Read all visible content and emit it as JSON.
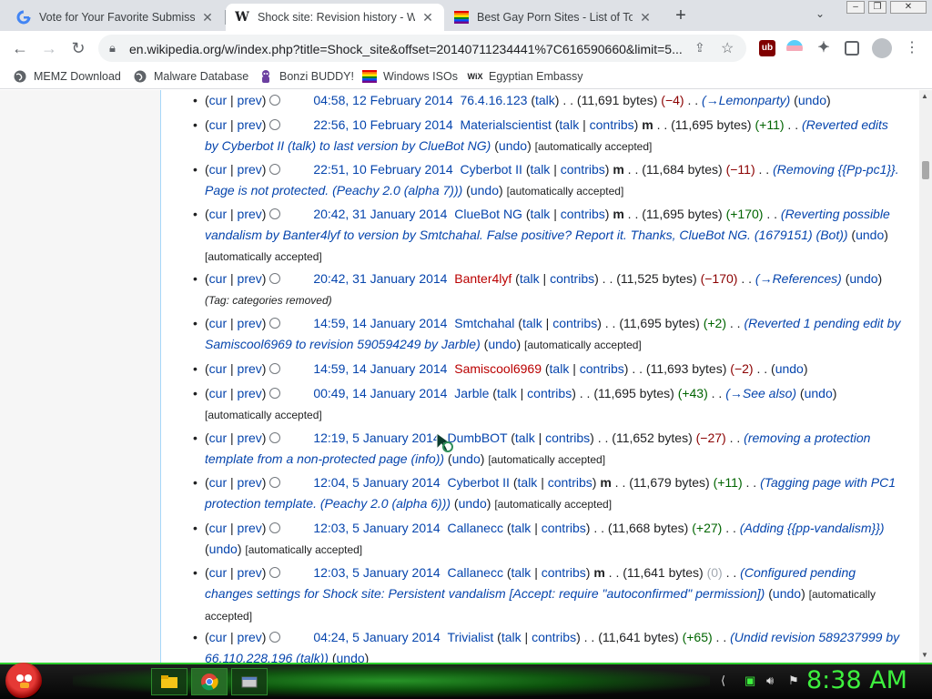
{
  "browser": {
    "tabs": [
      {
        "title": "Vote for Your Favorite Submissio",
        "icon": "google-icon"
      },
      {
        "title": "Shock site: Revision history - Wik",
        "icon": "wikipedia-icon"
      },
      {
        "title": "Best Gay Porn Sites - List of Top (",
        "icon": "rainbow-flag-icon"
      }
    ],
    "url": "en.wikipedia.org/w/index.php?title=Shock_site&offset=20140711234441%7C616590660&limit=5...",
    "bookmarks": [
      {
        "label": "MEMZ Download",
        "icon": "globe-icon"
      },
      {
        "label": "Malware Database",
        "icon": "globe-icon"
      },
      {
        "label": "Bonzi BUDDY!",
        "icon": "bonzi-icon"
      },
      {
        "label": "Windows ISOs",
        "icon": "windows-flag-icon"
      },
      {
        "label": "Egyptian Embassy",
        "icon": "wix-icon"
      }
    ]
  },
  "history": [
    {
      "date": "04:58, 12 February 2014",
      "user": "76.4.16.123",
      "user_links": [
        "talk"
      ],
      "minor": false,
      "bytes": "(11,691 bytes)",
      "diff": "(−4)",
      "diff_class": "neg",
      "comment": "(→Lemonparty)",
      "undo": "undo",
      "accepted": ""
    },
    {
      "date": "22:56, 10 February 2014",
      "user": "Materialscientist",
      "user_links": [
        "talk",
        "contribs"
      ],
      "minor": true,
      "bytes": "(11,695 bytes)",
      "diff": "(+11)",
      "diff_class": "pos",
      "comment": "(Reverted edits by Cyberbot II (talk) to last version by ClueBot NG)",
      "undo": "undo",
      "accepted": "[automatically accepted]"
    },
    {
      "date": "22:51, 10 February 2014",
      "user": "Cyberbot II",
      "user_links": [
        "talk",
        "contribs"
      ],
      "minor": true,
      "bytes": "(11,684 bytes)",
      "diff": "(−11)",
      "diff_class": "neg",
      "comment": "(Removing {{Pp-pc1}}. Page is not protected. (Peachy 2.0 (alpha 7)))",
      "undo": "undo",
      "accepted": "[automatically accepted]"
    },
    {
      "date": "20:42, 31 January 2014",
      "user": "ClueBot NG",
      "user_links": [
        "talk",
        "contribs"
      ],
      "minor": true,
      "bytes": "(11,695 bytes)",
      "diff": "(+170)",
      "diff_class": "pos",
      "comment": "(Reverting possible vandalism by Banter4lyf to version by Smtchahal. False positive? Report it. Thanks, ClueBot NG. (1679151) (Bot))",
      "undo": "undo",
      "accepted": "[automatically accepted]"
    },
    {
      "date": "20:42, 31 January 2014",
      "user": "Banter4lyf",
      "user_links": [
        "talk",
        "contribs"
      ],
      "minor": false,
      "bytes": "(11,525 bytes)",
      "diff": "(−170)",
      "diff_class": "neg",
      "comment": "(→References)",
      "undo": "undo",
      "accepted": "",
      "tag": "(Tag: categories removed)"
    },
    {
      "date": "14:59, 14 January 2014",
      "user": "Smtchahal",
      "user_links": [
        "talk",
        "contribs"
      ],
      "minor": false,
      "bytes": "(11,695 bytes)",
      "diff": "(+2)",
      "diff_class": "pos",
      "comment": "(Reverted 1 pending edit by Samiscool6969 to revision 590594249 by Jarble)",
      "undo": "undo",
      "accepted": "[automatically accepted]"
    },
    {
      "date": "14:59, 14 January 2014",
      "user": "Samiscool6969",
      "user_links": [
        "talk",
        "contribs"
      ],
      "minor": false,
      "bytes": "(11,693 bytes)",
      "diff": "(−2)",
      "diff_class": "neg",
      "comment": "",
      "undo": "undo",
      "accepted": ""
    },
    {
      "date": "00:49, 14 January 2014",
      "user": "Jarble",
      "user_links": [
        "talk",
        "contribs"
      ],
      "minor": false,
      "bytes": "(11,695 bytes)",
      "diff": "(+43)",
      "diff_class": "pos",
      "comment": "(→See also)",
      "undo": "undo",
      "accepted": "[automatically accepted]"
    },
    {
      "date": "12:19, 5 January 2014",
      "user": "DumbBOT",
      "user_links": [
        "talk",
        "contribs"
      ],
      "minor": false,
      "bytes": "(11,652 bytes)",
      "diff": "(−27)",
      "diff_class": "neg",
      "comment": "(removing a protection template from a non-protected page (info))",
      "undo": "undo",
      "accepted": "[automatically accepted]"
    },
    {
      "date": "12:04, 5 January 2014",
      "user": "Cyberbot II",
      "user_links": [
        "talk",
        "contribs"
      ],
      "minor": true,
      "bytes": "(11,679 bytes)",
      "diff": "(+11)",
      "diff_class": "pos",
      "comment": "(Tagging page with PC1 protection template. (Peachy 2.0 (alpha 6)))",
      "undo": "undo",
      "accepted": "[automatically accepted]"
    },
    {
      "date": "12:03, 5 January 2014",
      "user": "Callanecc",
      "user_links": [
        "talk",
        "contribs"
      ],
      "minor": false,
      "bytes": "(11,668 bytes)",
      "diff": "(+27)",
      "diff_class": "pos",
      "comment": "(Adding {{pp-vandalism}})",
      "undo": "undo",
      "accepted": "[automatically accepted]"
    },
    {
      "date": "12:03, 5 January 2014",
      "user": "Callanecc",
      "user_links": [
        "talk",
        "contribs"
      ],
      "minor": true,
      "bytes": "(11,641 bytes)",
      "diff": "(0)",
      "diff_class": "zero",
      "comment": "(Configured pending changes settings for Shock site: Persistent vandalism [Accept: require \"autoconfirmed\" permission])",
      "undo": "undo",
      "accepted": "[automatically accepted]"
    },
    {
      "date": "04:24, 5 January 2014",
      "user": "Trivialist",
      "user_links": [
        "talk",
        "contribs"
      ],
      "minor": false,
      "bytes": "(11,641 bytes)",
      "diff": "(+65)",
      "diff_class": "pos",
      "comment": "(Undid revision 589237999 by 66.110.228.196 (talk))",
      "undo": "undo",
      "accepted": ""
    }
  ],
  "labels": {
    "cur": "cur",
    "prev": "prev",
    "minor": "m",
    "sep": ". ."
  },
  "taskbar": {
    "clock": "8:38 AM"
  }
}
